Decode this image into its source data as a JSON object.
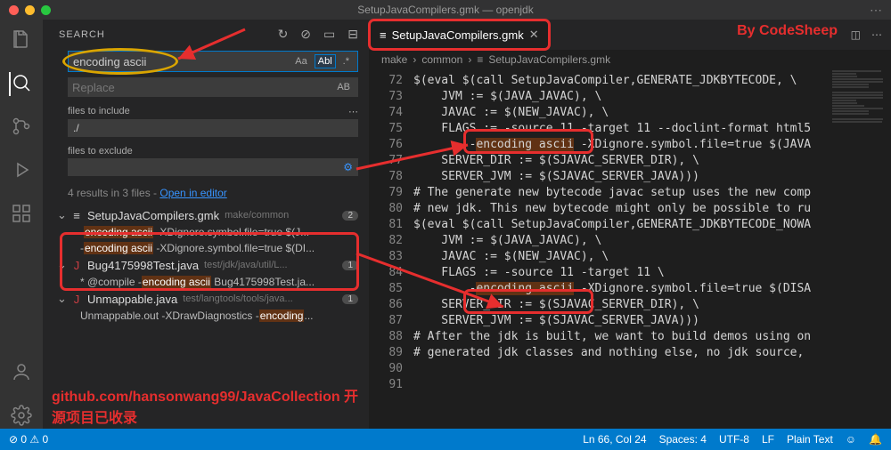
{
  "window": {
    "title": "SetupJavaCompilers.gmk — openjdk"
  },
  "annotation": {
    "byline": "By CodeSheep",
    "footer": "github.com/hansonwang99/JavaCollection 开源项目已收录"
  },
  "sidebar": {
    "title": "SEARCH",
    "search_value": "encoding ascii",
    "replace_placeholder": "Replace",
    "include_label": "files to include",
    "include_value": "./",
    "exclude_label": "files to exclude",
    "opt_case": "Aa",
    "opt_word": "Abl",
    "opt_regex": ".*",
    "opt_ab": "AB",
    "summary_text": "4 results in 3 files - ",
    "summary_link": "Open in editor",
    "files": [
      {
        "name": "SetupJavaCompilers.gmk",
        "path": "make/common",
        "count": "2",
        "icon": "≡",
        "iconColor": "#ccc",
        "matches": [
          {
            "pre": "-",
            "hit": "encoding ascii",
            "post": " -XDignore.symbol.file=true $(J..."
          },
          {
            "pre": "-",
            "hit": "encoding ascii",
            "post": " -XDignore.symbol.file=true $(DI..."
          }
        ]
      },
      {
        "name": "Bug4175998Test.java",
        "path": "test/jdk/java/util/L...",
        "count": "1",
        "icon": "J",
        "iconColor": "#cc3e44",
        "matches": [
          {
            "pre": "* @compile -",
            "hit": "encoding ascii",
            "post": " Bug4175998Test.ja..."
          }
        ]
      },
      {
        "name": "Unmappable.java",
        "path": "test/langtools/tools/java...",
        "count": "1",
        "icon": "J",
        "iconColor": "#cc3e44",
        "matches": [
          {
            "pre": "Unmappable.out -XDrawDiagnostics -",
            "hit": "encoding",
            "post": "..."
          }
        ]
      }
    ]
  },
  "editor": {
    "tab": {
      "icon": "≡",
      "label": "SetupJavaCompilers.gmk"
    },
    "crumb": [
      "make",
      "common",
      "SetupJavaCompilers.gmk"
    ],
    "line_start": 72,
    "lines": [
      "$(eval $(call SetupJavaCompiler,GENERATE_JDKBYTECODE, \\",
      "    JVM := $(JAVA_JAVAC), \\",
      "    JAVAC := $(NEW_JAVAC), \\",
      "    FLAGS := -source 11 -target 11 --doclint-format html5",
      "        -encoding ascii -XDignore.symbol.file=true $(JAVA",
      "    SERVER_DIR := $(SJAVAC_SERVER_DIR), \\",
      "    SERVER_JVM := $(SJAVAC_SERVER_JAVA)))",
      "",
      "# The generate new bytecode javac setup uses the new comp",
      "# new jdk. This new bytecode might only be possible to ru",
      "$(eval $(call SetupJavaCompiler,GENERATE_JDKBYTECODE_NOWA",
      "    JVM := $(JAVA_JAVAC), \\",
      "    JAVAC := $(NEW_JAVAC), \\",
      "    FLAGS := -source 11 -target 11 \\",
      "        -encoding ascii -XDignore.symbol.file=true $(DISA",
      "    SERVER_DIR := $(SJAVAC_SERVER_DIR), \\",
      "    SERVER_JVM := $(SJAVAC_SERVER_JAVA)))",
      "",
      "# After the jdk is built, we want to build demos using on",
      "# generated jdk classes and nothing else, no jdk source,"
    ],
    "highlight_token": "encoding ascii"
  },
  "status": {
    "errors": "0",
    "warnings": "0",
    "pos": "Ln 66, Col 24",
    "spaces": "Spaces: 4",
    "enc": "UTF-8",
    "eol": "LF",
    "lang": "Plain Text"
  }
}
